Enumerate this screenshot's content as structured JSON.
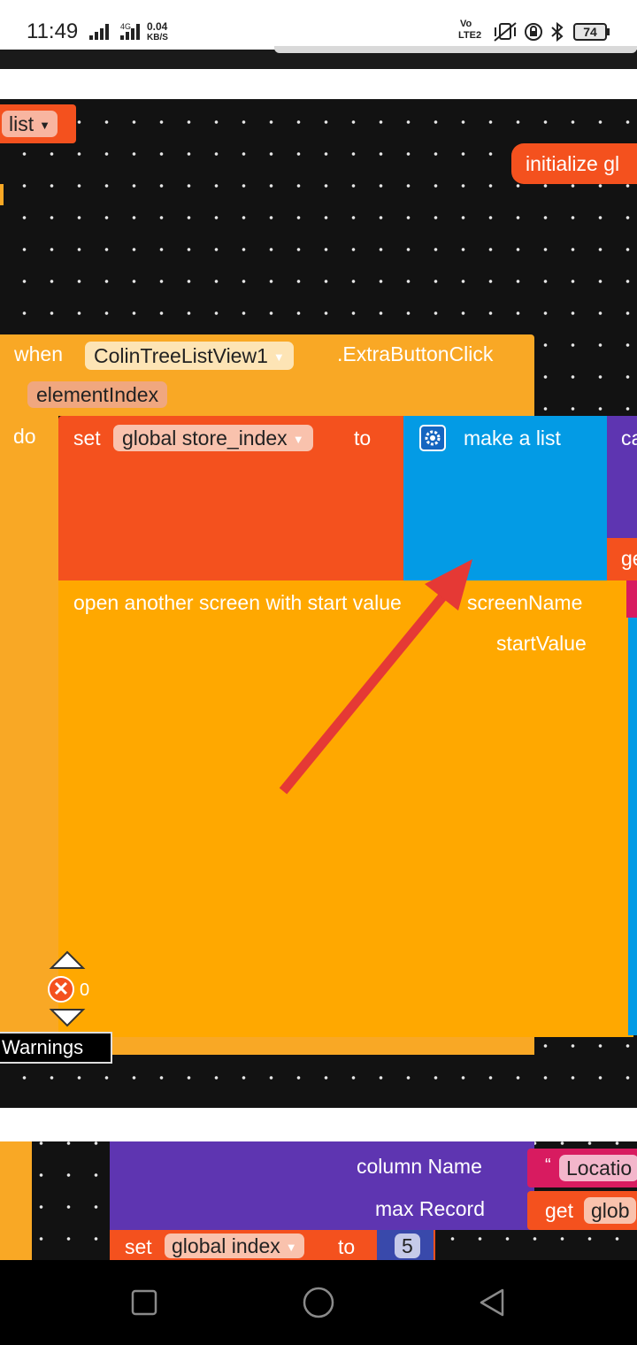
{
  "statusbar": {
    "time": "11:49",
    "network_speed_value": "0.04",
    "network_speed_unit": "KB/S",
    "lte_label_top": "Vo",
    "lte_label_bottom": "LTE2",
    "battery": "74",
    "icons": [
      "signal-icon",
      "signal-4g-icon",
      "mute-vibrate-icon",
      "rotation-lock-icon",
      "bluetooth-icon",
      "battery-icon"
    ]
  },
  "workspace": {
    "top_partial_block": "list",
    "initialize_block": "initialize gl",
    "event_block": {
      "when": "when",
      "component": "ColinTreeListView1",
      "event": ".ExtraButtonClick",
      "param": "elementIndex",
      "do": "do"
    },
    "set_block": {
      "set": "set",
      "variable": "global store_index",
      "to": "to"
    },
    "make_list_block": {
      "label": "make a list",
      "partial_right": "ca",
      "partial_get": "ge"
    },
    "open_screen_block": {
      "label": "open another screen with start value",
      "screen_name": "screenName",
      "start_value": "startValue"
    },
    "warnings": {
      "count": "0",
      "label": "Warnings"
    }
  },
  "lower_workspace": {
    "column_name": "column Name",
    "location_text": "Locatio",
    "max_record": "max Record",
    "get_label": "get",
    "get_var_partial": "glob",
    "set_label": "set",
    "set_variable": "global index",
    "to_label": "to",
    "number": "5"
  },
  "colors": {
    "event_orange": "#F9A825",
    "set_red": "#F4511E",
    "list_blue": "#039BE5",
    "purple": "#5E35B1",
    "annotation_arrow": "#E53935"
  },
  "navbar": {
    "icons": [
      "recent-apps-icon",
      "home-icon",
      "back-icon"
    ]
  }
}
